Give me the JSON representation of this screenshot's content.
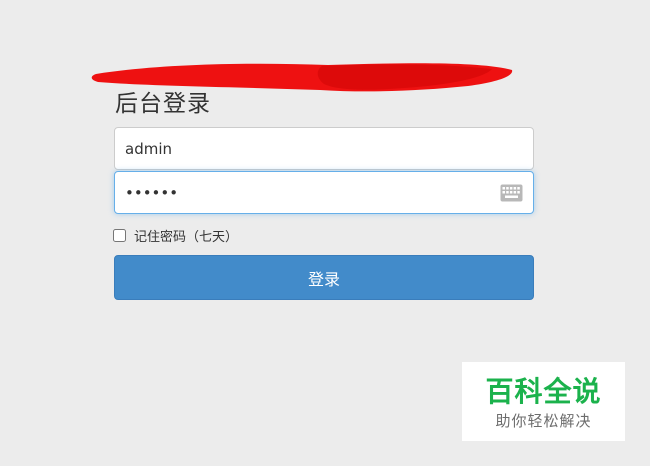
{
  "login": {
    "title": "后台登录",
    "username_value": "admin",
    "password_value": "123456",
    "remember_label": "记住密码（七天）",
    "remember_checked": false,
    "submit_label": "登录"
  },
  "icons": {
    "keyboard": "keyboard-icon"
  },
  "watermark": {
    "title": "百科全说",
    "subtitle": "助你轻松解决"
  },
  "colors": {
    "background": "#ececec",
    "primary_button": "#428bca",
    "focus_border": "#66afe9",
    "redaction": "#ee1111",
    "watermark_green": "#1bb24c"
  }
}
